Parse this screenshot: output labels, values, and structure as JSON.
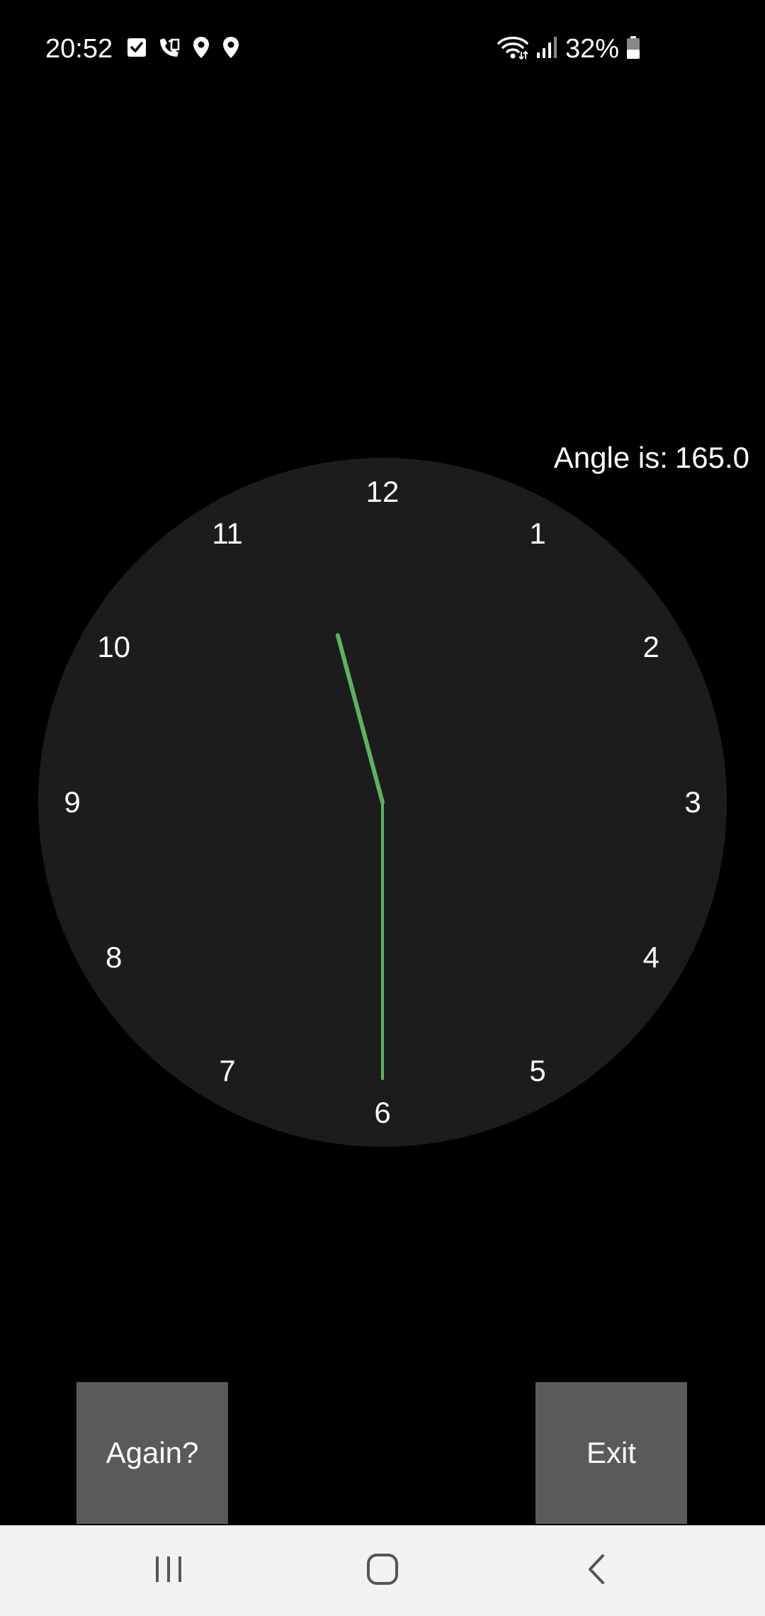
{
  "status_bar": {
    "time": "20:52",
    "left_icons": [
      "task-check-icon",
      "call-forward-icon",
      "location-pin-icon",
      "location-pin-icon"
    ],
    "right_icons": [
      "wifi-icon",
      "signal-icon"
    ],
    "battery_percent": "32%"
  },
  "angle": {
    "prefix": "Angle is:",
    "value": "165.0"
  },
  "clock": {
    "face_color": "#1c1c1c",
    "hand_color": "#5cb35e",
    "numbers": [
      "12",
      "1",
      "2",
      "3",
      "4",
      "5",
      "6",
      "7",
      "8",
      "9",
      "10",
      "11"
    ],
    "hour_hand_angle_deg": 345,
    "minute_hand_angle_deg": 180
  },
  "buttons": {
    "again_label": "Again?",
    "exit_label": "Exit"
  },
  "nav_bar": {
    "icons": [
      "recent-apps-icon",
      "home-icon",
      "back-icon"
    ]
  }
}
